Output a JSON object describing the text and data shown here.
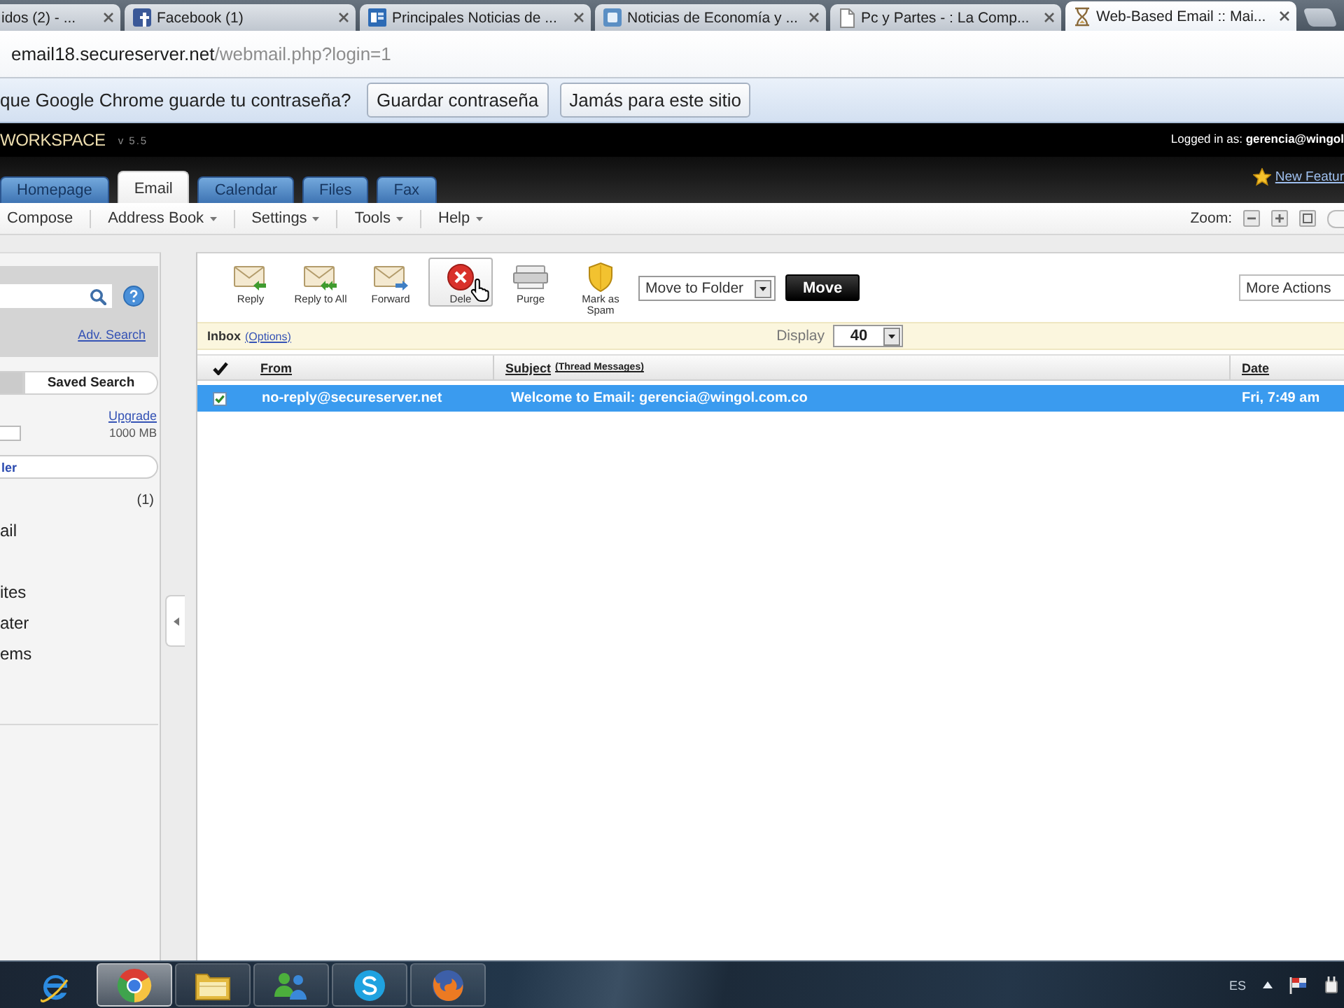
{
  "browser": {
    "tabs": [
      {
        "title": "idos (2) - ...",
        "selected": false
      },
      {
        "title": "Facebook (1)",
        "selected": false
      },
      {
        "title": "Principales Noticias de ...",
        "selected": false
      },
      {
        "title": "Noticias de Economía y ...",
        "selected": false
      },
      {
        "title": "Pc y Partes - : La Comp...",
        "selected": false
      },
      {
        "title": "Web-Based Email :: Mai...",
        "selected": true
      }
    ],
    "address": {
      "host": "email18.secureserver.net",
      "path": "/webmail.php?login=1"
    },
    "password_prompt": {
      "message": "que Google Chrome guarde tu contraseña?",
      "buttons": [
        "Guardar contraseña",
        "Jamás para este sitio"
      ]
    }
  },
  "workspace": {
    "brand": "WORKSPACE",
    "version": "v 5.5",
    "login": "Logged in as: **gerencia@wingol**",
    "tabs": [
      {
        "label": "Homepage",
        "selected": false
      },
      {
        "label": "Email",
        "selected": true
      },
      {
        "label": "Calendar",
        "selected": false
      },
      {
        "label": "Files",
        "selected": false
      },
      {
        "label": "Fax",
        "selected": false
      }
    ],
    "new_features": "New Featur",
    "menu": [
      {
        "label": "Compose",
        "dropdown": false
      },
      {
        "label": "Address Book",
        "dropdown": true
      },
      {
        "label": "Settings",
        "dropdown": true
      },
      {
        "label": "Tools",
        "dropdown": true
      },
      {
        "label": "Help",
        "dropdown": true
      }
    ],
    "zoom_label": "Zoom:"
  },
  "sidebar": {
    "adv_search": "Adv. Search",
    "search_tabs": [
      {
        "selected": true
      },
      {
        "label": "Saved Search",
        "selected": false
      }
    ],
    "upgrade": "Upgrade",
    "quota": "1000 MB",
    "folder_button": "ler",
    "folders": [
      {
        "count": "(1)"
      },
      {
        "name": "ail"
      },
      {
        "name": "ites"
      },
      {
        "name": "ater"
      },
      {
        "name": "ems"
      }
    ]
  },
  "mail": {
    "actions": [
      {
        "kind": "reply",
        "label": "Reply",
        "hovered": false
      },
      {
        "kind": "reply_all",
        "label": "Reply to All",
        "hovered": false
      },
      {
        "kind": "forward",
        "label": "Forward",
        "hovered": false
      },
      {
        "kind": "delete",
        "label": "Dele",
        "hovered": true
      },
      {
        "kind": "purge",
        "label": "Purge",
        "hovered": false
      },
      {
        "kind": "spam",
        "label": "Mark as Spam",
        "hovered": false
      }
    ],
    "move_select": "Move to Folder",
    "move_button": "Move",
    "more_actions": "More Actions",
    "folder": "Inbox",
    "options": "(Options)",
    "display_label": "Display",
    "display_value": "40",
    "columns": [
      {
        "label": "From"
      },
      {
        "label": "Subject",
        "note": "(Thread Messages)"
      },
      {
        "label": "Date"
      }
    ],
    "rows": [
      {
        "selected": true,
        "checked": true,
        "from": "no-reply@secureserver.net",
        "subject": "Welcome to Email: gerencia@wingol.com.co",
        "date": "Fri, 7:49 am"
      }
    ]
  },
  "taskbar": {
    "apps": [
      {
        "kind": "ie",
        "running": false,
        "active": false
      },
      {
        "kind": "chrome",
        "running": true,
        "active": true
      },
      {
        "kind": "explorer",
        "running": true,
        "active": false
      },
      {
        "kind": "messenger",
        "running": true,
        "active": false
      },
      {
        "kind": "skype",
        "running": true,
        "active": false
      },
      {
        "kind": "firefox",
        "running": true,
        "active": false
      }
    ],
    "language": "ES"
  }
}
